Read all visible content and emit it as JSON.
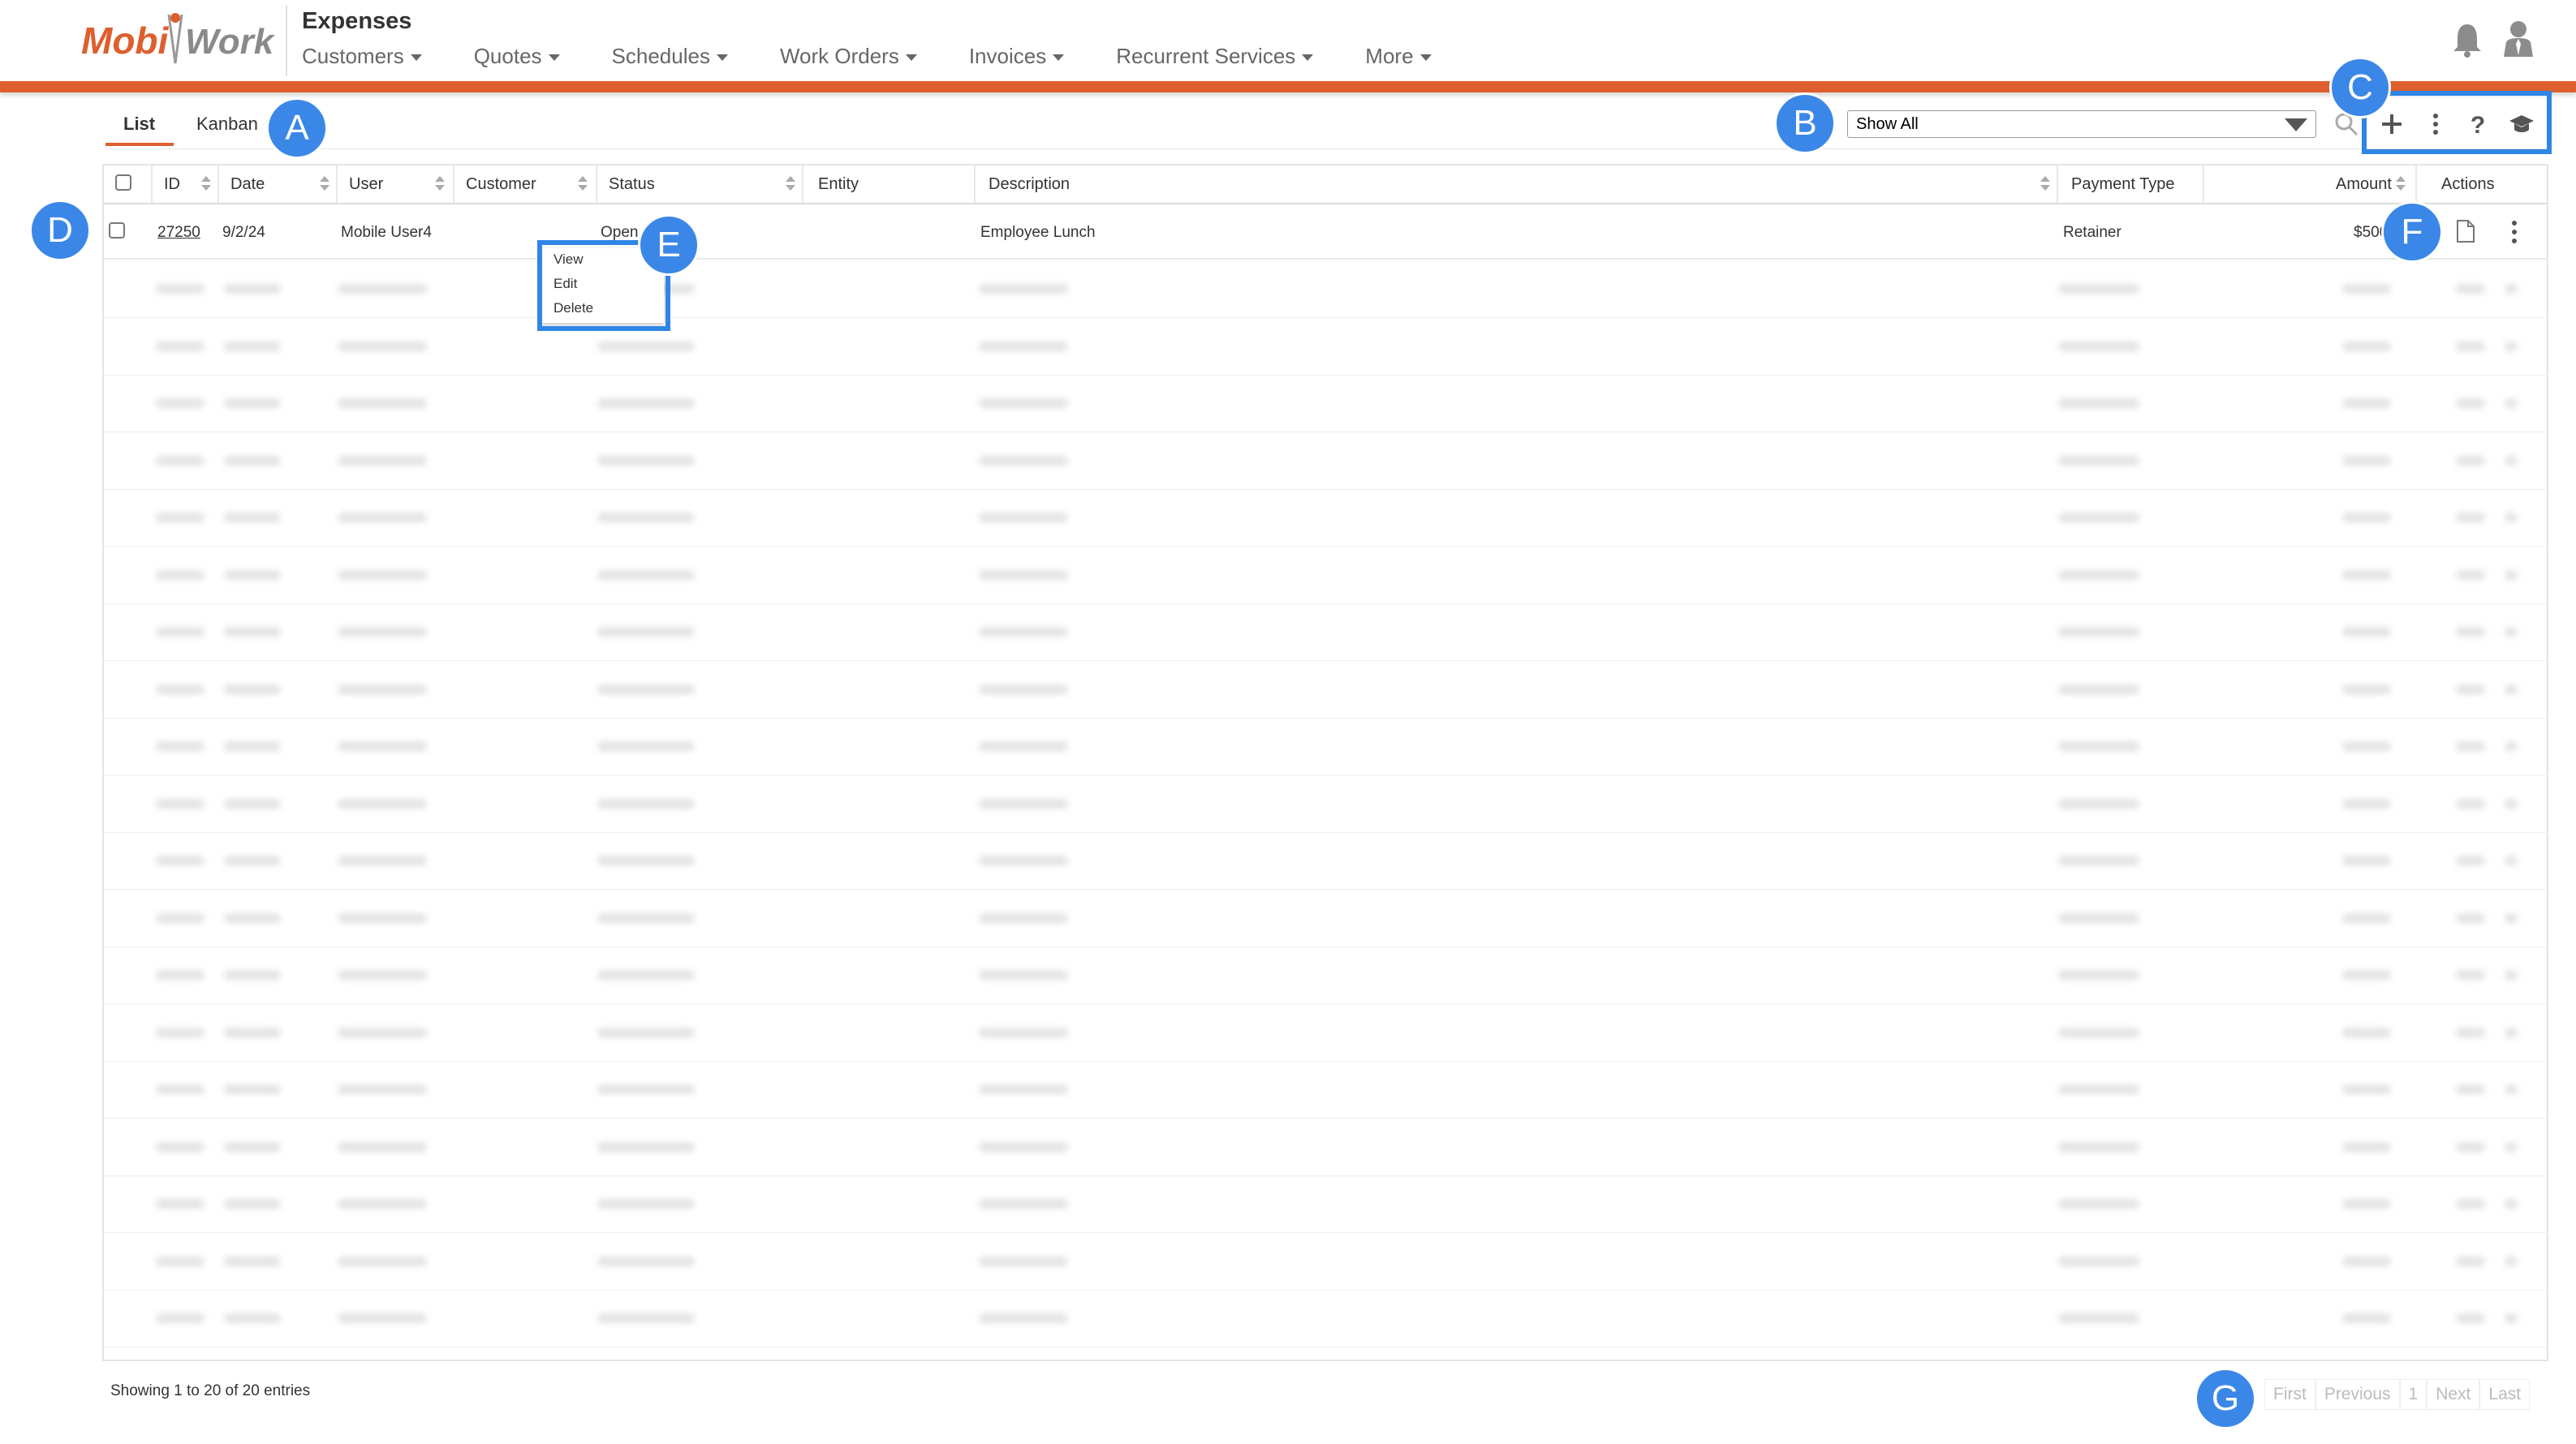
{
  "app": {
    "logo_text": "MobiWork",
    "page_title": "Expenses",
    "nav": [
      "Customers",
      "Quotes",
      "Schedules",
      "Work Orders",
      "Invoices",
      "Recurrent Services",
      "More"
    ]
  },
  "colors": {
    "brand_orange": "#dd5f2e",
    "annotation_blue": "#2f86e6"
  },
  "view_tabs": {
    "list": "List",
    "kanban": "Kanban",
    "active": "List"
  },
  "filter": {
    "selected": "Show All"
  },
  "toolbar_icons": [
    "search-icon",
    "add-icon",
    "more-vertical-icon",
    "help-icon",
    "graduation-cap-icon"
  ],
  "table": {
    "columns": [
      "ID",
      "Date",
      "User",
      "Customer",
      "Status",
      "Entity",
      "Description",
      "Payment Type",
      "Amount",
      "Actions"
    ],
    "rows": [
      {
        "id": "27250",
        "date": "9/2/24",
        "user": "Mobile User4",
        "customer": "",
        "status": "Open",
        "entity": "",
        "description": "Employee Lunch",
        "payment_type": "Retainer",
        "amount": "$500"
      }
    ]
  },
  "context_menu": {
    "items": [
      "View",
      "Edit",
      "Delete"
    ]
  },
  "footer": {
    "info": "Showing 1 to 20 of 20 entries",
    "pager": [
      "First",
      "Previous",
      "1",
      "Next",
      "Last"
    ]
  },
  "annotations": [
    "A",
    "B",
    "C",
    "D",
    "E",
    "F",
    "G"
  ]
}
